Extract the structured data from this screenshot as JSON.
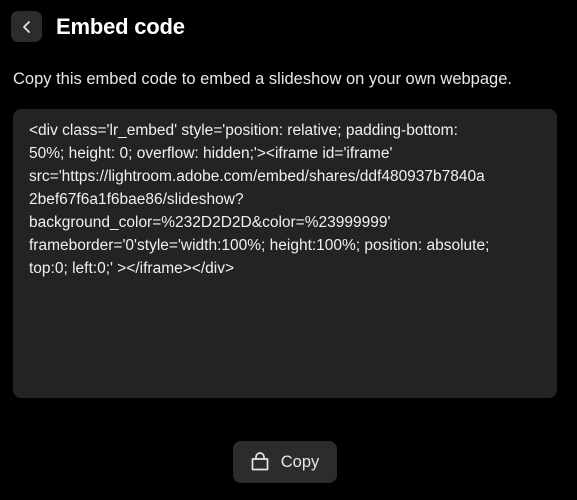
{
  "header": {
    "back_icon": "chevron-left-icon",
    "title": "Embed code"
  },
  "description": "Copy this embed code to embed a slideshow on your own webpage.",
  "embed_code": {
    "text": "<div class='lr_embed' style='position: relative; padding-bottom:\n50%; height: 0; overflow: hidden;'><iframe id='iframe'\nsrc='https://lightroom.adobe.com/embed/shares/ddf480937b7840a\n2bef67f6a1f6bae86/slideshow?\nbackground_color=%232D2D2D&color=%23999999'\nframeborder='0'style='width:100%; height:100%; position: absolute;\ntop:0; left:0;' ></iframe></div>"
  },
  "copy_button": {
    "icon": "shopping-bag-icon",
    "label": "Copy"
  },
  "colors": {
    "background": "#000000",
    "surface": "#232323",
    "button": "#2c2c2c",
    "text": "#ffffff"
  }
}
